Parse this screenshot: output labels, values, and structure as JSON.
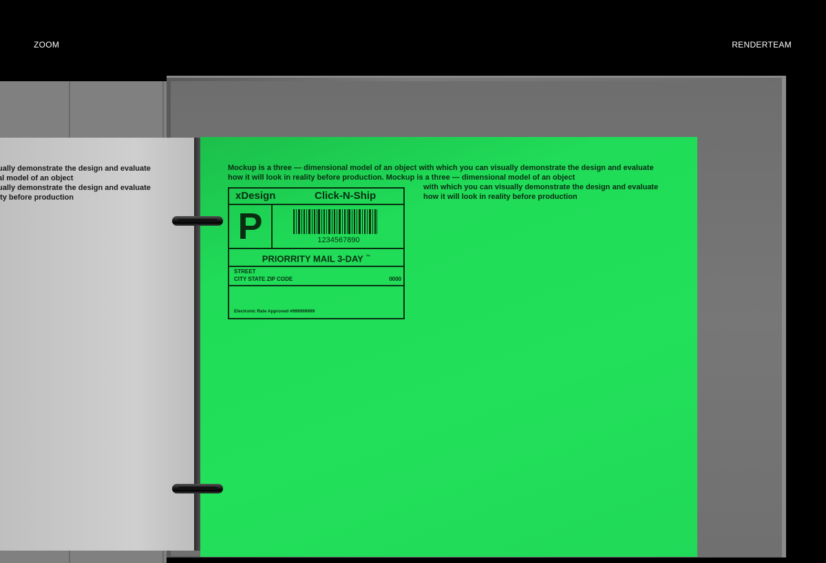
{
  "header": {
    "left_label": "ZOOM",
    "right_label": "RENDERTEAM"
  },
  "left_page": {
    "text": "ually demonstrate the design and evaluate\nal model of an object\nually demonstrate the design and evaluate\nity before production"
  },
  "right_page": {
    "paragraph_top": "Mockup is a three — dimensional model of an object with which you can visually demonstrate the design and evaluate\nhow it will look in reality before production. Mockup is a three — dimensional model of an object",
    "paragraph_right": "with which you can visually demonstrate the design and evaluate\nhow it will look in reality before production",
    "label": {
      "brand": "xDesign",
      "service": "Click-N-Ship",
      "big_letter": "P",
      "barcode_number": "1234567890",
      "mail_class": "PRIORRITY MAIL 3-DAY",
      "trademark": "™",
      "street": "STREET",
      "city_state_zip": "CITY STATE ZIP CODE",
      "zip_code": "0000",
      "rate_note": "Electronic Rate Approved #999999999"
    }
  },
  "colors": {
    "background": "#000000",
    "page_green": "#22e05a",
    "page_grey": "#c8c8c8",
    "binder_grey": "#777777",
    "ink": "#0a2d12"
  }
}
